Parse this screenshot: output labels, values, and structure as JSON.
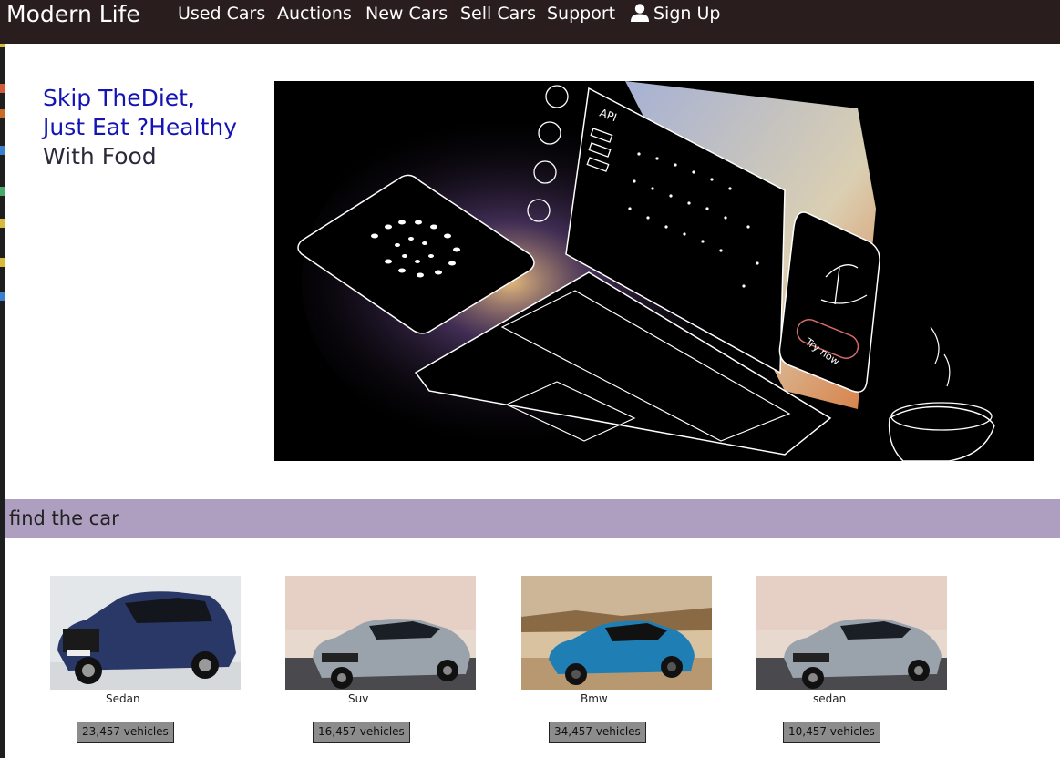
{
  "navbar": {
    "brand": "Modern Life",
    "links": [
      "Used Cars",
      "Auctions",
      "New Cars",
      "Sell Cars",
      "Support"
    ],
    "signup": "Sign Up",
    "user_icon": "user-icon"
  },
  "hero": {
    "line1": "Skip TheDiet,",
    "line2": "Just Eat ?Healthy",
    "line3": "With Food",
    "image": {
      "api_label": "API",
      "try_now": "Try now"
    }
  },
  "find": {
    "title": "find the car"
  },
  "cars": [
    {
      "label": "Sedan",
      "count": "23,457 vehicles"
    },
    {
      "label": "Suv",
      "count": "16,457 vehicles"
    },
    {
      "label": "Bmw",
      "count": "34,457 vehicles"
    },
    {
      "label": "sedan",
      "count": "10,457 vehicles"
    }
  ],
  "colors": {
    "navbar": "#2a1d1d",
    "hero_heading": "#1414b4",
    "find_bar": "#ae9fc0"
  }
}
